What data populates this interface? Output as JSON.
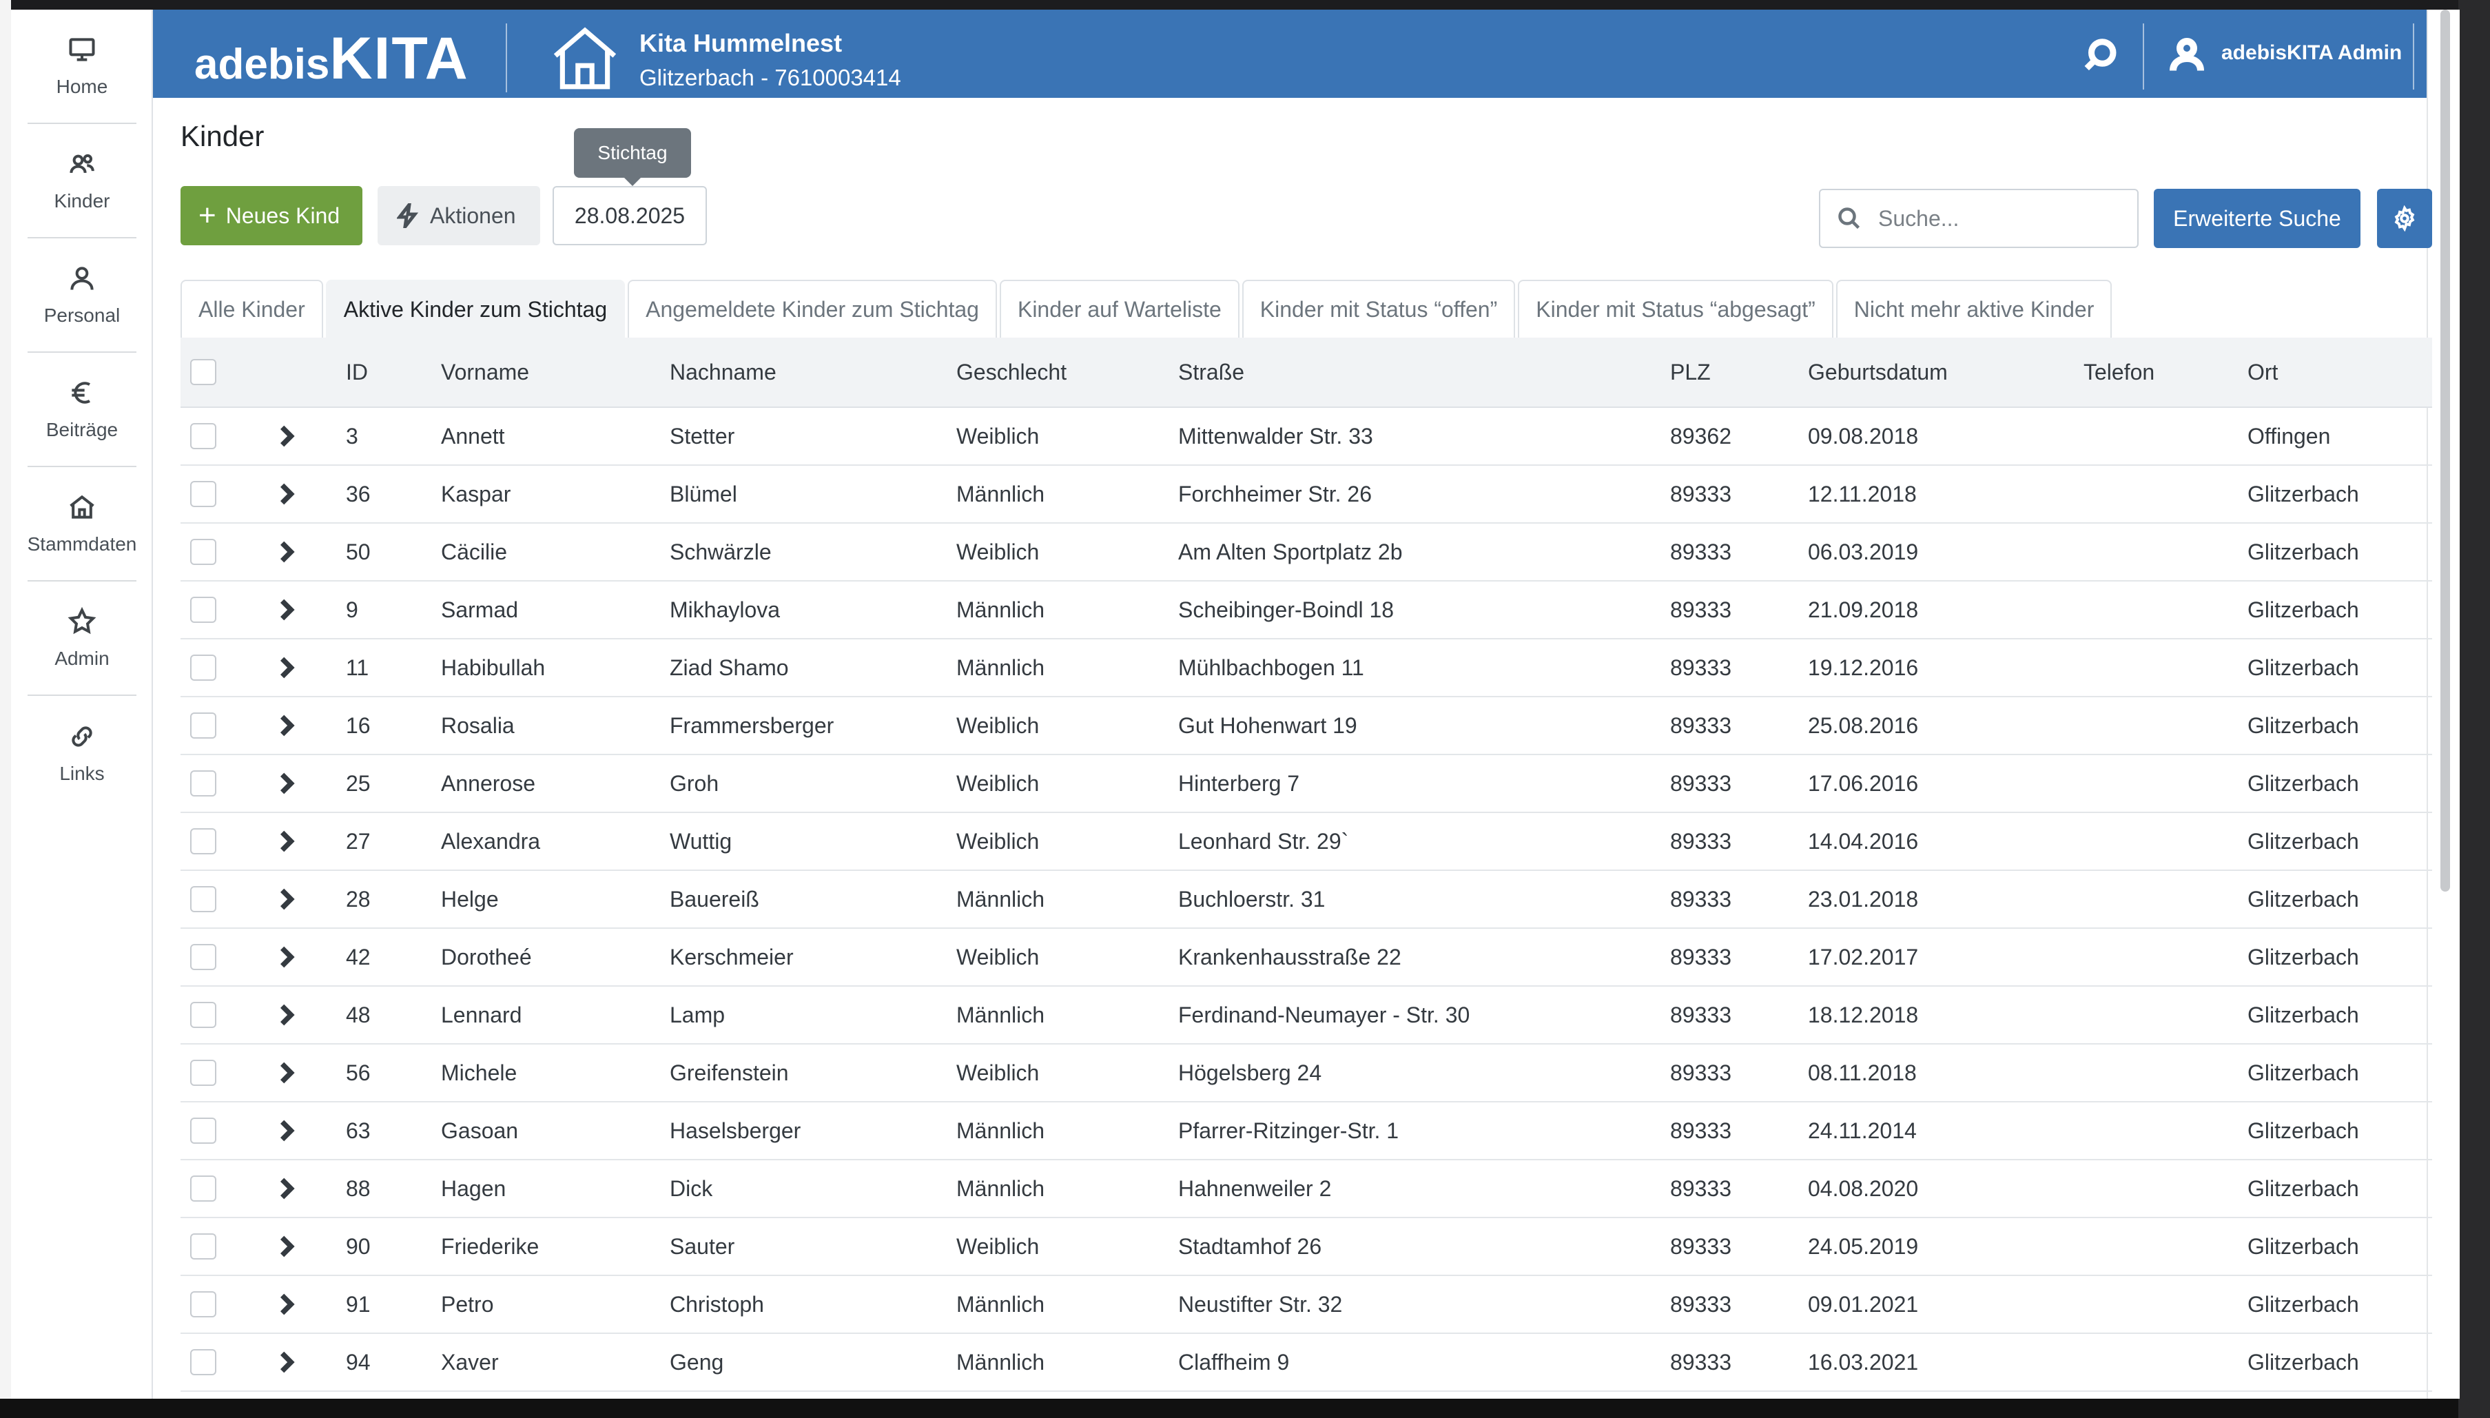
{
  "sidebar": {
    "items": [
      {
        "label": "Home",
        "icon": "monitor-icon"
      },
      {
        "label": "Kinder",
        "icon": "users-icon"
      },
      {
        "label": "Personal",
        "icon": "user-icon"
      },
      {
        "label": "Beiträge",
        "icon": "euro-icon"
      },
      {
        "label": "Stammdaten",
        "icon": "home-icon"
      },
      {
        "label": "Admin",
        "icon": "star-icon"
      },
      {
        "label": "Links",
        "icon": "link-icon"
      }
    ]
  },
  "header": {
    "brand_part1": "adebis",
    "brand_part2": "KITA",
    "org_name": "Kita Hummelnest",
    "org_sub": "Glitzerbach - 7610003414",
    "user_name": "adebisKITA Admin",
    "color": "#3a74b5"
  },
  "page": {
    "title": "Kinder",
    "tooltip": "Stichtag",
    "new_button": "Neues Kind",
    "actions_button": "Aktionen",
    "date_value": "28.08.2025",
    "search_placeholder": "Suche...",
    "advanced_search": "Erweiterte Suche"
  },
  "tabs": [
    {
      "label": "Alle Kinder",
      "active": false
    },
    {
      "label": "Aktive Kinder zum Stichtag",
      "active": true
    },
    {
      "label": "Angemeldete Kinder zum Stichtag",
      "active": false
    },
    {
      "label": "Kinder auf Warteliste",
      "active": false
    },
    {
      "label": "Kinder mit Status “offen”",
      "active": false
    },
    {
      "label": "Kinder mit Status “abgesagt”",
      "active": false
    },
    {
      "label": "Nicht mehr aktive Kinder",
      "active": false
    }
  ],
  "table": {
    "columns": [
      "ID",
      "Vorname",
      "Nachname",
      "Geschlecht",
      "Straße",
      "PLZ",
      "Geburtsdatum",
      "Telefon",
      "Ort"
    ],
    "rows": [
      [
        "3",
        "Annett",
        "Stetter",
        "Weiblich",
        "Mittenwalder Str. 33",
        "89362",
        "09.08.2018",
        "",
        "Offingen"
      ],
      [
        "36",
        "Kaspar",
        "Blümel",
        "Männlich",
        "Forchheimer Str. 26",
        "89333",
        "12.11.2018",
        "",
        "Glitzerbach"
      ],
      [
        "50",
        "Cäcilie",
        "Schwärzle",
        "Weiblich",
        "Am Alten Sportplatz 2b",
        "89333",
        "06.03.2019",
        "",
        "Glitzerbach"
      ],
      [
        "9",
        "Sarmad",
        "Mikhaylova",
        "Männlich",
        "Scheibinger-Boindl 18",
        "89333",
        "21.09.2018",
        "",
        "Glitzerbach"
      ],
      [
        "11",
        "Habibullah",
        "Ziad Shamo",
        "Männlich",
        "Mühlbachbogen 11",
        "89333",
        "19.12.2016",
        "",
        "Glitzerbach"
      ],
      [
        "16",
        "Rosalia",
        "Frammersberger",
        "Weiblich",
        "Gut Hohenwart 19",
        "89333",
        "25.08.2016",
        "",
        "Glitzerbach"
      ],
      [
        "25",
        "Annerose",
        "Groh",
        "Weiblich",
        "Hinterberg 7",
        "89333",
        "17.06.2016",
        "",
        "Glitzerbach"
      ],
      [
        "27",
        "Alexandra",
        "Wuttig",
        "Weiblich",
        "Leonhard Str. 29`",
        "89333",
        "14.04.2016",
        "",
        "Glitzerbach"
      ],
      [
        "28",
        "Helge",
        "Bauereiß",
        "Männlich",
        "Buchloerstr. 31",
        "89333",
        "23.01.2018",
        "",
        "Glitzerbach"
      ],
      [
        "42",
        "Dorotheé",
        "Kerschmeier",
        "Weiblich",
        "Krankenhausstraße 22",
        "89333",
        "17.02.2017",
        "",
        "Glitzerbach"
      ],
      [
        "48",
        "Lennard",
        "Lamp",
        "Männlich",
        "Ferdinand-Neumayer - Str. 30",
        "89333",
        "18.12.2018",
        "",
        "Glitzerbach"
      ],
      [
        "56",
        "Michele",
        "Greifenstein",
        "Weiblich",
        "Högelsberg 24",
        "89333",
        "08.11.2018",
        "",
        "Glitzerbach"
      ],
      [
        "63",
        "Gasoan",
        "Haselsberger",
        "Männlich",
        "Pfarrer-Ritzinger-Str. 1",
        "89333",
        "24.11.2014",
        "",
        "Glitzerbach"
      ],
      [
        "88",
        "Hagen",
        "Dick",
        "Männlich",
        "Hahnenweiler 2",
        "89333",
        "04.08.2020",
        "",
        "Glitzerbach"
      ],
      [
        "90",
        "Friederike",
        "Sauter",
        "Weiblich",
        "Stadtamhof 26",
        "89333",
        "24.05.2019",
        "",
        "Glitzerbach"
      ],
      [
        "91",
        "Petro",
        "Christoph",
        "Männlich",
        "Neustifter Str. 32",
        "89333",
        "09.01.2021",
        "",
        "Glitzerbach"
      ],
      [
        "94",
        "Xaver",
        "Geng",
        "Männlich",
        "Claffheim 9",
        "89333",
        "16.03.2021",
        "",
        "Glitzerbach"
      ]
    ]
  }
}
